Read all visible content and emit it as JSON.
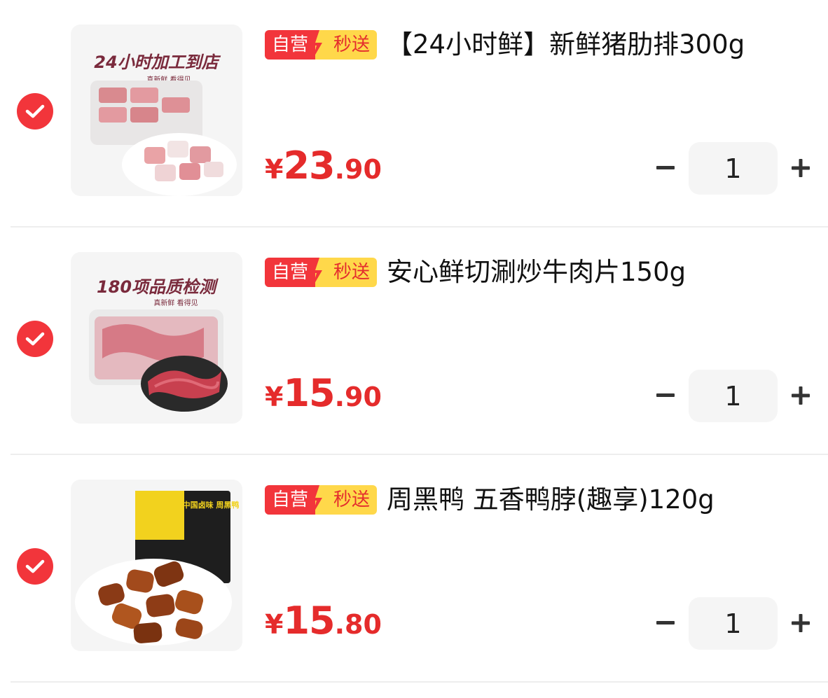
{
  "tags": {
    "self_operated": "自营",
    "flash_delivery": "秒送"
  },
  "colors": {
    "accent_red": "#f2353b",
    "price_red": "#e52b2b",
    "tag_yellow": "#ffd84a"
  },
  "items": [
    {
      "selected": true,
      "title": "【24小时鲜】新鲜猪肋排300g",
      "image_banner": "24小时加工到店",
      "image_sub": "真新鲜 看得见",
      "price_currency": "¥",
      "price_int": "23",
      "price_dec": ".90",
      "quantity": "1",
      "minus_label": "−",
      "plus_label": "+"
    },
    {
      "selected": true,
      "title": "安心鲜切涮炒牛肉片150g",
      "image_banner": "180项品质检测",
      "image_sub": "真新鲜 看得见",
      "price_currency": "¥",
      "price_int": "15",
      "price_dec": ".90",
      "quantity": "1",
      "minus_label": "−",
      "plus_label": "+"
    },
    {
      "selected": true,
      "title": "周黑鸭 五香鸭脖(趣享)120g",
      "image_banner": "中国卤味 周黑鸭",
      "image_sub": "",
      "price_currency": "¥",
      "price_int": "15",
      "price_dec": ".80",
      "quantity": "1",
      "minus_label": "−",
      "plus_label": "+"
    }
  ]
}
